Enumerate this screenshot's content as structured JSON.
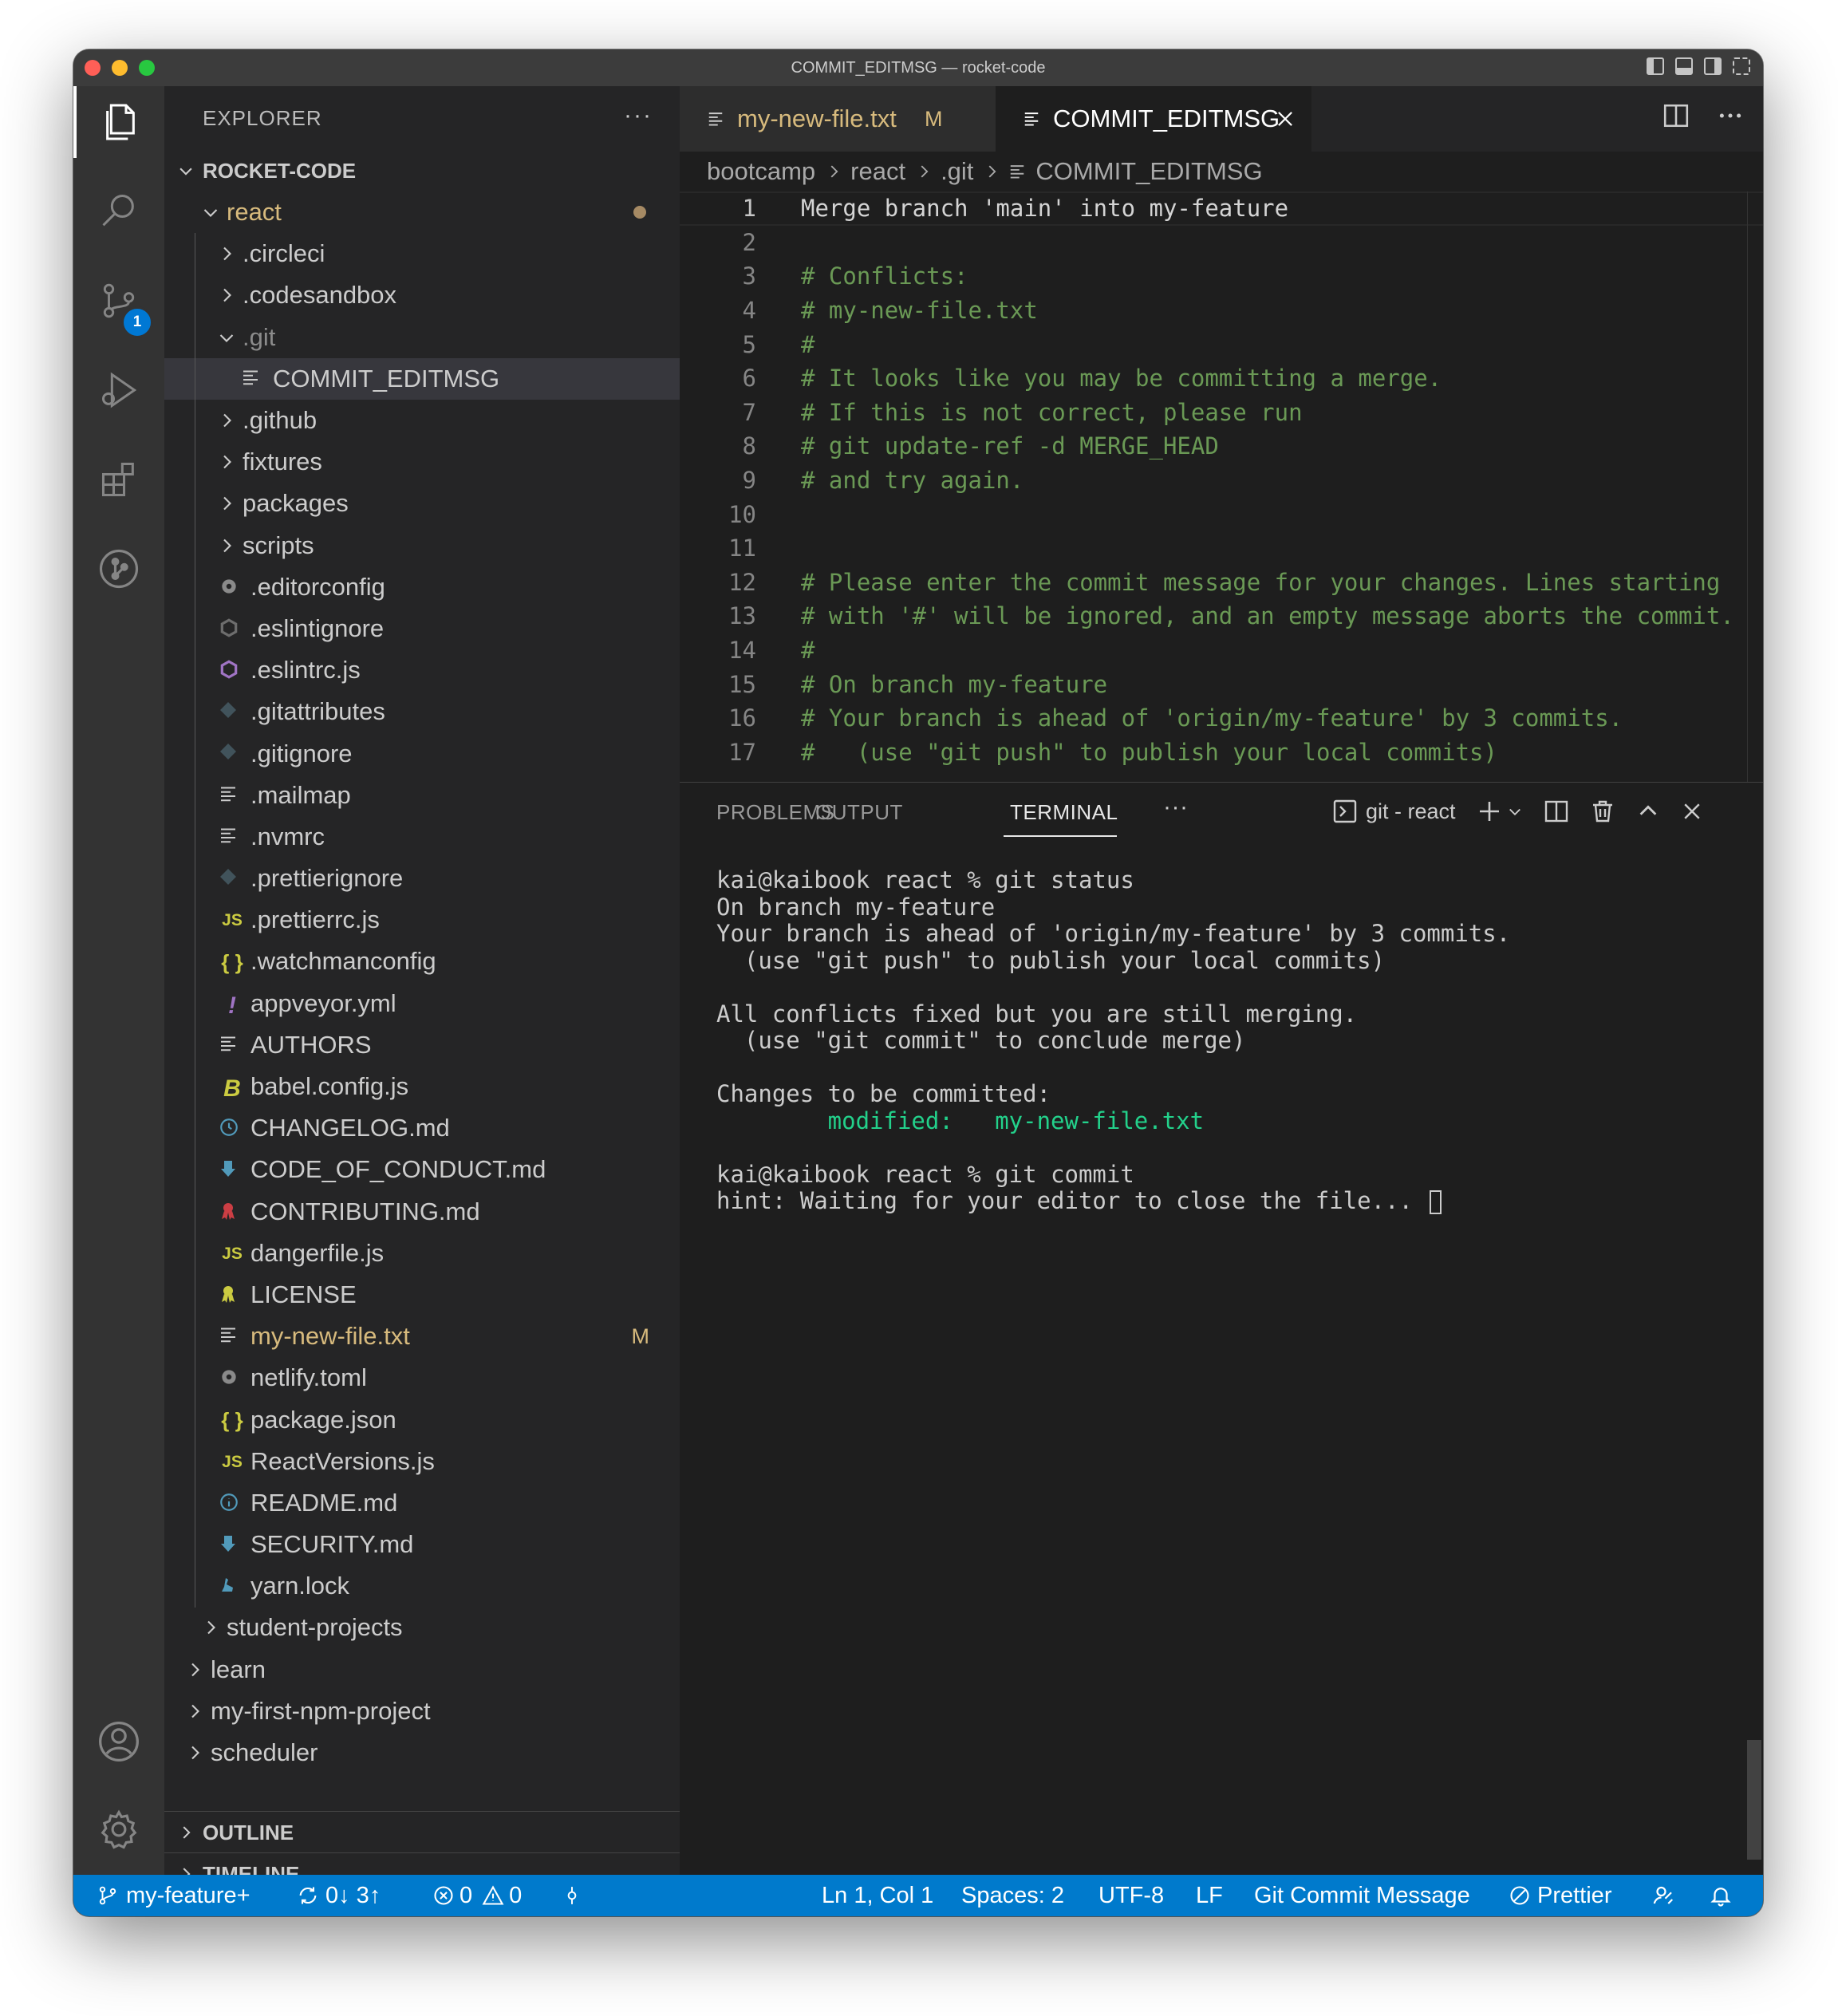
{
  "window": {
    "title": "COMMIT_EDITMSG — rocket-code"
  },
  "activity": {
    "scm_badge": "1"
  },
  "sidebar": {
    "header": "EXPLORER",
    "more": "···",
    "root": "ROCKET-CODE",
    "items": [
      {
        "label": "react",
        "kind": "folder-open",
        "depth": 1,
        "style": "modified-dot"
      },
      {
        "label": ".circleci",
        "kind": "folder",
        "depth": 2
      },
      {
        "label": ".codesandbox",
        "kind": "folder",
        "depth": 2
      },
      {
        "label": ".git",
        "kind": "folder-open",
        "depth": 2,
        "style": "dim"
      },
      {
        "label": "COMMIT_EDITMSG",
        "kind": "file-lines",
        "depth": 3,
        "style": "selected"
      },
      {
        "label": ".github",
        "kind": "folder",
        "depth": 2
      },
      {
        "label": "fixtures",
        "kind": "folder",
        "depth": 2
      },
      {
        "label": "packages",
        "kind": "folder",
        "depth": 2
      },
      {
        "label": "scripts",
        "kind": "folder",
        "depth": 2
      },
      {
        "label": ".editorconfig",
        "kind": "gear",
        "depth": 2
      },
      {
        "label": ".eslintignore",
        "kind": "eslint-gray",
        "depth": 2
      },
      {
        "label": ".eslintrc.js",
        "kind": "eslint-purple",
        "depth": 2
      },
      {
        "label": ".gitattributes",
        "kind": "git-diamond",
        "depth": 2
      },
      {
        "label": ".gitignore",
        "kind": "git-diamond",
        "depth": 2
      },
      {
        "label": ".mailmap",
        "kind": "file-lines",
        "depth": 2
      },
      {
        "label": ".nvmrc",
        "kind": "file-lines",
        "depth": 2
      },
      {
        "label": ".prettierignore",
        "kind": "git-diamond",
        "depth": 2
      },
      {
        "label": ".prettierrc.js",
        "kind": "js",
        "depth": 2
      },
      {
        "label": ".watchmanconfig",
        "kind": "braces",
        "depth": 2
      },
      {
        "label": "appveyor.yml",
        "kind": "exclaim",
        "depth": 2
      },
      {
        "label": "AUTHORS",
        "kind": "file-lines",
        "depth": 2
      },
      {
        "label": "babel.config.js",
        "kind": "babel",
        "depth": 2
      },
      {
        "label": "CHANGELOG.md",
        "kind": "clock",
        "depth": 2
      },
      {
        "label": "CODE_OF_CONDUCT.md",
        "kind": "arrow-down",
        "depth": 2
      },
      {
        "label": "CONTRIBUTING.md",
        "kind": "ribbon-red",
        "depth": 2
      },
      {
        "label": "dangerfile.js",
        "kind": "js",
        "depth": 2
      },
      {
        "label": "LICENSE",
        "kind": "ribbon-yellow",
        "depth": 2
      },
      {
        "label": "my-new-file.txt",
        "kind": "file-lines",
        "depth": 2,
        "style": "modified",
        "flag": "M"
      },
      {
        "label": "netlify.toml",
        "kind": "gear",
        "depth": 2
      },
      {
        "label": "package.json",
        "kind": "braces",
        "depth": 2
      },
      {
        "label": "ReactVersions.js",
        "kind": "js",
        "depth": 2
      },
      {
        "label": "README.md",
        "kind": "info",
        "depth": 2
      },
      {
        "label": "SECURITY.md",
        "kind": "arrow-down",
        "depth": 2
      },
      {
        "label": "yarn.lock",
        "kind": "yarn",
        "depth": 2
      },
      {
        "label": "student-projects",
        "kind": "folder",
        "depth": 1
      },
      {
        "label": "learn",
        "kind": "folder",
        "depth": 0
      },
      {
        "label": "my-first-npm-project",
        "kind": "folder",
        "depth": 0
      },
      {
        "label": "scheduler",
        "kind": "folder",
        "depth": 0
      }
    ],
    "outline": "OUTLINE",
    "timeline": "TIMELINE"
  },
  "tabs": [
    {
      "label": "my-new-file.txt",
      "flag": "M"
    },
    {
      "label": "COMMIT_EDITMSG"
    }
  ],
  "breadcrumb": [
    "bootcamp",
    "react",
    ".git",
    "COMMIT_EDITMSG"
  ],
  "editor": {
    "lines": [
      "Merge branch 'main' into my-feature",
      "",
      "# Conflicts:",
      "# my-new-file.txt",
      "#",
      "# It looks like you may be committing a merge.",
      "# If this is not correct, please run",
      "# git update-ref -d MERGE_HEAD",
      "# and try again.",
      "",
      "",
      "# Please enter the commit message for your changes. Lines starting",
      "# with '#' will be ignored, and an empty message aborts the commit.",
      "#",
      "# On branch my-feature",
      "# Your branch is ahead of 'origin/my-feature' by 3 commits.",
      "#   (use \"git push\" to publish your local commits)"
    ]
  },
  "panel": {
    "tabs": [
      "PROBLEMS",
      "OUTPUT",
      "TERMINAL"
    ],
    "more": "···",
    "terminal_name": "git - react",
    "terminal": {
      "l1": "kai@kaibook react % git status",
      "l2": "On branch my-feature",
      "l3": "Your branch is ahead of 'origin/my-feature' by 3 commits.",
      "l4": "  (use \"git push\" to publish your local commits)",
      "l5": "",
      "l6": "All conflicts fixed but you are still merging.",
      "l7": "  (use \"git commit\" to conclude merge)",
      "l8": "",
      "l9": "Changes to be committed:",
      "l10_label": "        modified:",
      "l10_file": "   my-new-file.txt",
      "l11": "",
      "l12": "kai@kaibook react % git commit",
      "l13": "hint: Waiting for your editor to close the file... "
    }
  },
  "status": {
    "branch": "my-feature+",
    "sync": "0↓ 3↑",
    "errors": "0",
    "warnings": "0",
    "position": "Ln 1, Col 1",
    "spaces": "Spaces: 2",
    "encoding": "UTF-8",
    "eol": "LF",
    "language": "Git Commit Message",
    "prettier": "Prettier"
  },
  "colors": {
    "accent": "#007acc",
    "modified": "#d7ba7d",
    "comment": "#6a9955",
    "terminal_green": "#23d18b"
  }
}
